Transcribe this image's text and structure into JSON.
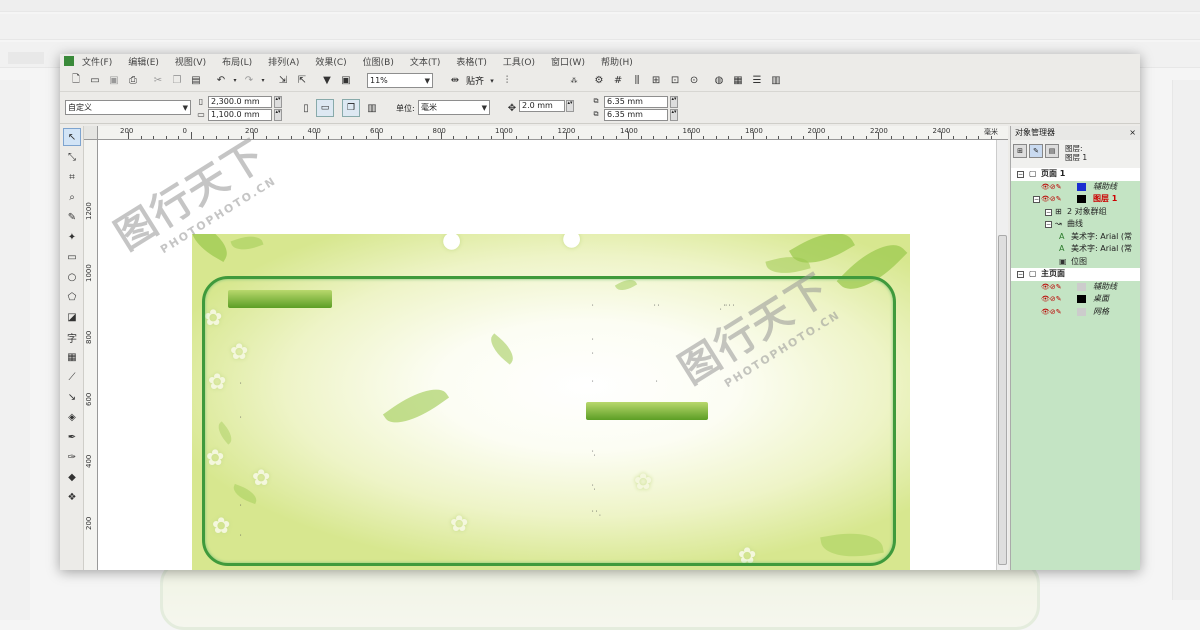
{
  "menu": [
    "文件(F)",
    "编辑(E)",
    "视图(V)",
    "布局(L)",
    "排列(A)",
    "效果(C)",
    "位图(B)",
    "文本(T)",
    "表格(T)",
    "工具(O)",
    "窗口(W)",
    "帮助(H)"
  ],
  "toolbar": {
    "zoom": "11%",
    "snap_label": "贴齐"
  },
  "propbar": {
    "page_size": "自定义",
    "width": "2,300.0 mm",
    "height": "1,100.0 mm",
    "units_label": "单位:",
    "units": "毫米",
    "nudge": "2.0 mm",
    "dup_x": "6.35 mm",
    "dup_y": "6.35 mm"
  },
  "ruler": {
    "top_labels": [
      "200",
      "0",
      "200",
      "400",
      "600",
      "800",
      "1000",
      "1200",
      "1400",
      "1600",
      "1800",
      "2000",
      "2200",
      "2400"
    ],
    "unit": "毫米",
    "left_labels": [
      "1200",
      "1000",
      "800",
      "600",
      "400",
      "200"
    ]
  },
  "watermark": {
    "brand": "图行天下",
    "sub": "PHOTOPHOTO.CN"
  },
  "object_manager": {
    "title": "对象管理器",
    "layer_label": "图层:",
    "current_layer": "图层 1",
    "tree": [
      {
        "label": "页面 1",
        "level": 0,
        "type": "page"
      },
      {
        "label": "辅助线",
        "level": 1,
        "type": "layer",
        "color": "#1a2fd0"
      },
      {
        "label": "图层 1",
        "level": 1,
        "type": "layer",
        "color": "#000000",
        "active": true
      },
      {
        "label": "2 对象群组",
        "level": 2,
        "type": "group"
      },
      {
        "label": "曲线",
        "level": 2,
        "type": "curve"
      },
      {
        "label": "美术字: Arial (常",
        "level": 3,
        "type": "text"
      },
      {
        "label": "美术字: Arial (常",
        "level": 3,
        "type": "text"
      },
      {
        "label": "位图",
        "level": 3,
        "type": "bitmap"
      },
      {
        "label": "主页面",
        "level": 0,
        "type": "page"
      },
      {
        "label": "辅助线",
        "level": 1,
        "type": "layer",
        "color": "#cccccc"
      },
      {
        "label": "桌面",
        "level": 1,
        "type": "layer",
        "color": "#000000"
      },
      {
        "label": "网格",
        "level": 1,
        "type": "layer",
        "color": "#cccccc"
      }
    ]
  },
  "colors": {
    "frame": "#3f9a3c",
    "panel_bg": "#c4e4c4",
    "accent_red": "#cc0000"
  }
}
